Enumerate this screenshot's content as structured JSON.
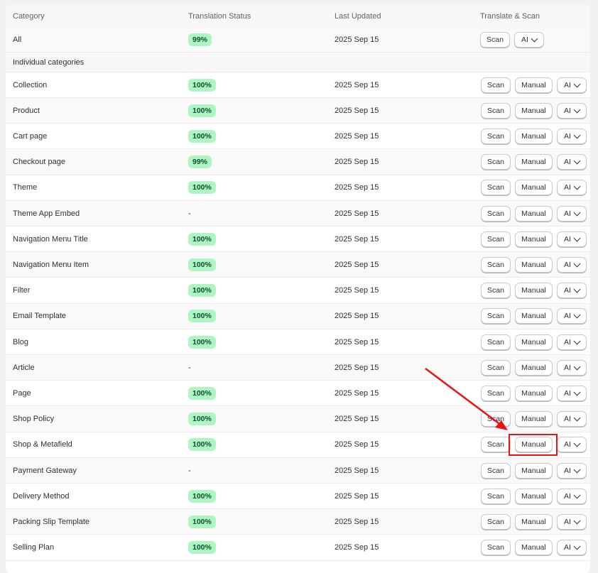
{
  "header": {
    "category": "Category",
    "status": "Translation Status",
    "updated": "Last Updated",
    "actions": "Translate & Scan"
  },
  "all_row": {
    "name": "All",
    "status": "99%",
    "updated": "2025 Sep 15",
    "scan": "Scan",
    "ai": "AI"
  },
  "section_label": "Individual categories",
  "buttons": {
    "scan": "Scan",
    "manual": "Manual",
    "ai": "AI"
  },
  "rows": [
    {
      "name": "Collection",
      "status": "100%",
      "updated": "2025 Sep 15"
    },
    {
      "name": "Product",
      "status": "100%",
      "updated": "2025 Sep 15"
    },
    {
      "name": "Cart page",
      "status": "100%",
      "updated": "2025 Sep 15"
    },
    {
      "name": "Checkout page",
      "status": "99%",
      "updated": "2025 Sep 15"
    },
    {
      "name": "Theme",
      "status": "100%",
      "updated": "2025 Sep 15"
    },
    {
      "name": "Theme App Embed",
      "status": "-",
      "updated": "2025 Sep 15"
    },
    {
      "name": "Navigation Menu Title",
      "status": "100%",
      "updated": "2025 Sep 15"
    },
    {
      "name": "Navigation Menu Item",
      "status": "100%",
      "updated": "2025 Sep 15"
    },
    {
      "name": "Filter",
      "status": "100%",
      "updated": "2025 Sep 15"
    },
    {
      "name": "Email Template",
      "status": "100%",
      "updated": "2025 Sep 15"
    },
    {
      "name": "Blog",
      "status": "100%",
      "updated": "2025 Sep 15"
    },
    {
      "name": "Article",
      "status": "-",
      "updated": "2025 Sep 15"
    },
    {
      "name": "Page",
      "status": "100%",
      "updated": "2025 Sep 15"
    },
    {
      "name": "Shop Policy",
      "status": "100%",
      "updated": "2025 Sep 15"
    },
    {
      "name": "Shop & Metafield",
      "status": "100%",
      "updated": "2025 Sep 15"
    },
    {
      "name": "Payment Gateway",
      "status": "-",
      "updated": "2025 Sep 15"
    },
    {
      "name": "Delivery Method",
      "status": "100%",
      "updated": "2025 Sep 15"
    },
    {
      "name": "Packing Slip Template",
      "status": "100%",
      "updated": "2025 Sep 15"
    },
    {
      "name": "Selling Plan",
      "status": "100%",
      "updated": "2025 Sep 15"
    }
  ],
  "colors": {
    "badge_bg": "#aff5c3",
    "annotation": "#ee1111"
  }
}
